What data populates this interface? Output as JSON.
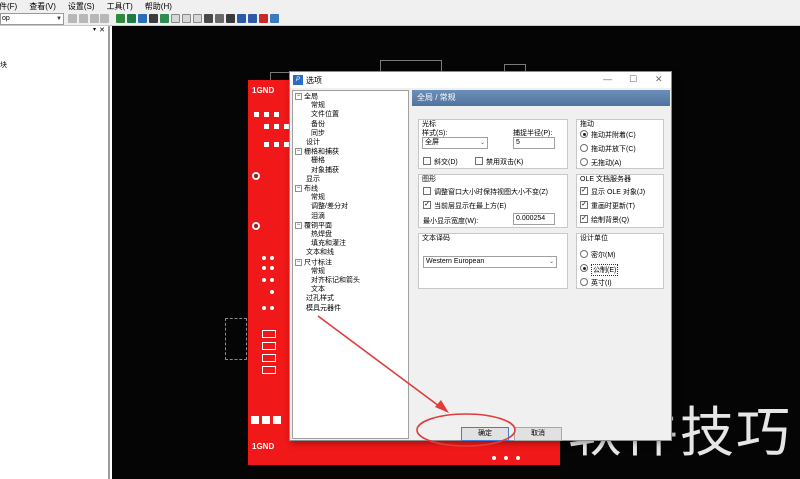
{
  "menubar": {
    "items": [
      "件(F)",
      "查看(V)",
      "设置(S)",
      "工具(T)",
      "帮助(H)"
    ]
  },
  "toolbar": {
    "layer_select": "op"
  },
  "left_panel": {
    "partial_text": "块"
  },
  "canvas": {
    "gnd_top": "1GND",
    "gnd_bottom": "1GND"
  },
  "dialog": {
    "title": "选项",
    "minimize_glyph": "—",
    "maximize_glyph": "☐",
    "close_glyph": "✕",
    "tree": [
      {
        "label": "全局",
        "level": 0,
        "expander": "−"
      },
      {
        "label": "常规",
        "level": 1
      },
      {
        "label": "文件位置",
        "level": 1
      },
      {
        "label": "备份",
        "level": 1
      },
      {
        "label": "同步",
        "level": 1
      },
      {
        "label": "设计",
        "level": 0
      },
      {
        "label": "栅格和捕获",
        "level": 0,
        "expander": "−"
      },
      {
        "label": "栅格",
        "level": 1
      },
      {
        "label": "对象捕获",
        "level": 1
      },
      {
        "label": "显示",
        "level": 0
      },
      {
        "label": "布线",
        "level": 0,
        "expander": "−"
      },
      {
        "label": "常规",
        "level": 1
      },
      {
        "label": "调整/差分对",
        "level": 1
      },
      {
        "label": "泪滴",
        "level": 1
      },
      {
        "label": "覆铜平面",
        "level": 0,
        "expander": "−"
      },
      {
        "label": "热焊盘",
        "level": 1
      },
      {
        "label": "填充和灌注",
        "level": 1
      },
      {
        "label": "文本和线",
        "level": 0
      },
      {
        "label": "尺寸标注",
        "level": 0,
        "expander": "−"
      },
      {
        "label": "常规",
        "level": 1
      },
      {
        "label": "对齐标记和箭头",
        "level": 1
      },
      {
        "label": "文本",
        "level": 1
      },
      {
        "label": "过孔样式",
        "level": 0
      },
      {
        "label": "模具元器件",
        "level": 0
      }
    ],
    "header": "全局 / 常规",
    "cursor": {
      "title": "光标",
      "style_label": "样式(S):",
      "style_value": "全屏",
      "radius_label": "捕捉半径(P):",
      "radius_value": "5",
      "cross_label": "斜交(D)",
      "cross_checked": false,
      "disable_dblclick_label": "禁用双击(K)",
      "disable_dblclick_checked": false
    },
    "drag": {
      "title": "拖动",
      "options": [
        {
          "label": "拖动并附着(C)",
          "selected": true
        },
        {
          "label": "拖动并放下(C)",
          "selected": false
        },
        {
          "label": "无拖动(A)",
          "selected": false
        }
      ]
    },
    "graphics": {
      "title": "图形",
      "keep_view_label": "调整窗口大小时保持视图大小不变(Z)",
      "keep_view_checked": false,
      "current_layer_top_label": "当前层显示在最上方(E)",
      "current_layer_top_checked": true,
      "min_width_label": "最小显示宽度(W):",
      "min_width_value": "0.000254"
    },
    "ole": {
      "title": "OLE 文档服务器",
      "show_ole_label": "显示 OLE 对象(J)",
      "show_ole_checked": true,
      "redraw_label": "重画时更新(T)",
      "redraw_checked": true,
      "draw_bg_label": "绘制背景(Q)",
      "draw_bg_checked": true
    },
    "text_encoding": {
      "title": "文本译码",
      "value": "Western European"
    },
    "units": {
      "title": "设计单位",
      "options": [
        {
          "label": "密尔(M)",
          "selected": false
        },
        {
          "label": "公制(E)",
          "selected": true
        },
        {
          "label": "英寸(I)",
          "selected": false
        }
      ]
    },
    "ok_label": "确定",
    "cancel_label": "取消"
  },
  "watermark": "软件技巧",
  "colors": {
    "pcb_red": "#f01818",
    "canvas_black": "#050505",
    "annotation_red": "#e03c3c",
    "dialog_header_blue": "#5a7ea9"
  }
}
